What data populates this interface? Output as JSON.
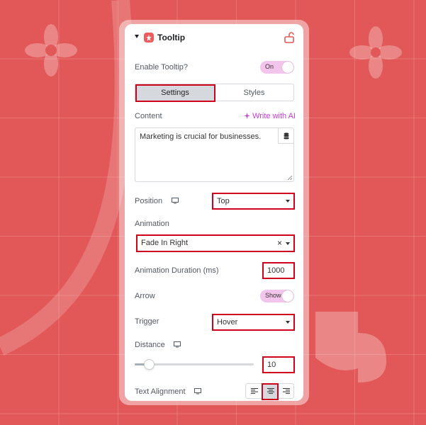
{
  "colors": {
    "background": "#e25858",
    "accent_toggle": "#f4c5ec",
    "ai_link": "#c43cd4",
    "highlight": "#d0021b",
    "header_icon": "#f05a5a"
  },
  "panel": {
    "title": "Tooltip",
    "header_icons": [
      "caret-down-icon",
      "tooltip-widget-icon",
      "unlock-icon"
    ]
  },
  "enable_tooltip": {
    "label": "Enable Tooltip?",
    "toggle_text": "On",
    "on": true
  },
  "tabs": [
    {
      "label": "Settings",
      "active": true
    },
    {
      "label": "Styles",
      "active": false
    }
  ],
  "content": {
    "label": "Content",
    "ai_link": "Write with AI",
    "value": "Marketing is crucial for businesses.",
    "icons": [
      "sparkle-icon",
      "database-icon"
    ]
  },
  "position": {
    "label": "Position",
    "value": "Top",
    "icon": "monitor-icon"
  },
  "animation": {
    "label": "Animation",
    "value": "Fade In Right",
    "clear_symbol": "×"
  },
  "animation_duration": {
    "label": "Animation Duration (ms)",
    "value": "1000"
  },
  "arrow": {
    "label": "Arrow",
    "toggle_text": "Show",
    "on": true
  },
  "trigger": {
    "label": "Trigger",
    "value": "Hover"
  },
  "distance": {
    "label": "Distance",
    "value": "10",
    "slider_fraction": 0.12,
    "icon": "monitor-icon"
  },
  "text_alignment": {
    "label": "Text Alignment",
    "icon": "monitor-icon",
    "options": [
      "align-left-icon",
      "align-center-icon",
      "align-right-icon"
    ],
    "selected": "align-center-icon"
  }
}
